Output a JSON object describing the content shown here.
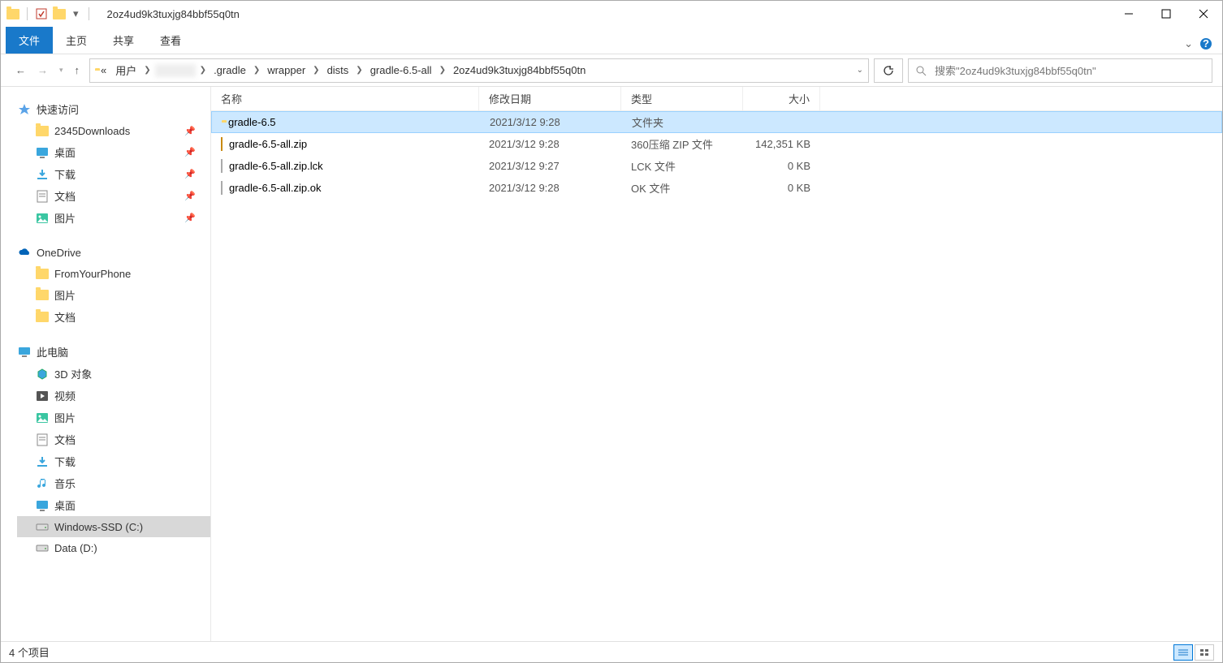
{
  "window": {
    "title": "2oz4ud9k3tuxjg84bbf55q0tn"
  },
  "ribbon": {
    "file": "文件",
    "tabs": [
      "主页",
      "共享",
      "查看"
    ]
  },
  "breadcrumb": {
    "prefix": "«",
    "parts": [
      "用户",
      "",
      ".gradle",
      "wrapper",
      "dists",
      "gradle-6.5-all",
      "2oz4ud9k3tuxjg84bbf55q0tn"
    ]
  },
  "search": {
    "placeholder": "搜索\"2oz4ud9k3tuxjg84bbf55q0tn\""
  },
  "sidebar": {
    "quick": {
      "label": "快速访问",
      "items": [
        {
          "label": "2345Downloads",
          "pin": true,
          "icon": "folder"
        },
        {
          "label": "桌面",
          "pin": true,
          "icon": "desktop"
        },
        {
          "label": "下载",
          "pin": true,
          "icon": "downloads"
        },
        {
          "label": "文档",
          "pin": true,
          "icon": "documents"
        },
        {
          "label": "图片",
          "pin": true,
          "icon": "pictures"
        }
      ]
    },
    "onedrive": {
      "label": "OneDrive",
      "items": [
        {
          "label": "FromYourPhone",
          "icon": "folder"
        },
        {
          "label": "图片",
          "icon": "folder"
        },
        {
          "label": "文档",
          "icon": "folder"
        }
      ]
    },
    "pc": {
      "label": "此电脑",
      "items": [
        {
          "label": "3D 对象",
          "icon": "3d"
        },
        {
          "label": "视频",
          "icon": "videos"
        },
        {
          "label": "图片",
          "icon": "pictures"
        },
        {
          "label": "文档",
          "icon": "documents"
        },
        {
          "label": "下载",
          "icon": "downloads"
        },
        {
          "label": "音乐",
          "icon": "music"
        },
        {
          "label": "桌面",
          "icon": "desktop"
        },
        {
          "label": "Windows-SSD (C:)",
          "icon": "drive",
          "sel": true
        },
        {
          "label": "Data (D:)",
          "icon": "drive"
        }
      ]
    }
  },
  "columns": {
    "name": "名称",
    "date": "修改日期",
    "type": "类型",
    "size": "大小"
  },
  "rows": [
    {
      "name": "gradle-6.5",
      "date": "2021/3/12 9:28",
      "type": "文件夹",
      "size": "",
      "icon": "folder",
      "sel": true
    },
    {
      "name": "gradle-6.5-all.zip",
      "date": "2021/3/12 9:28",
      "type": "360压缩 ZIP 文件",
      "size": "142,351 KB",
      "icon": "zip"
    },
    {
      "name": "gradle-6.5-all.zip.lck",
      "date": "2021/3/12 9:27",
      "type": "LCK 文件",
      "size": "0 KB",
      "icon": "file"
    },
    {
      "name": "gradle-6.5-all.zip.ok",
      "date": "2021/3/12 9:28",
      "type": "OK 文件",
      "size": "0 KB",
      "icon": "file"
    }
  ],
  "status": {
    "text": "4 个项目"
  }
}
